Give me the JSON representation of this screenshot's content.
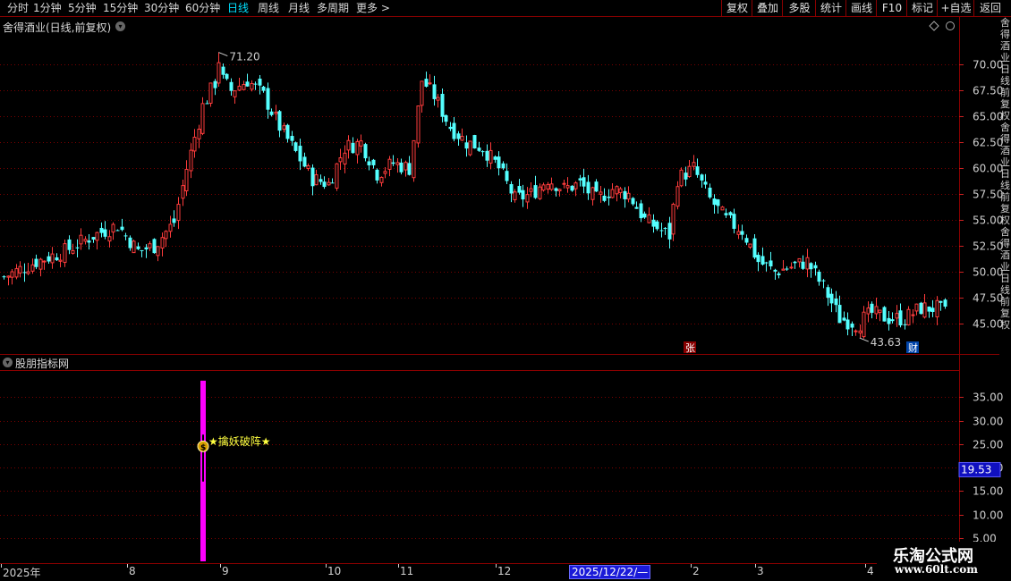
{
  "toolbar": {
    "periods": [
      "分时",
      "1分钟",
      "5分钟",
      "15分钟",
      "30分钟",
      "60分钟",
      "日线",
      "周线",
      "月线",
      "多周期",
      "更多 >"
    ],
    "active_period": "日线",
    "right_buttons": [
      "复权",
      "叠加",
      "多股",
      "统计",
      "画线",
      "F10",
      "标记",
      "+自选",
      "返回"
    ]
  },
  "main_pane": {
    "title": "舍得酒业(日线,前复权)",
    "high_label": "71.20",
    "low_label": "43.63",
    "badge_zhang": "张",
    "badge_cai": "财",
    "price_ticks": [
      "70.00",
      "67.50",
      "65.00",
      "62.50",
      "60.00",
      "57.50",
      "55.00",
      "52.50",
      "50.00",
      "47.50",
      "45.00"
    ]
  },
  "right_strip_text": "舍得酒业日线前复权",
  "indicator_pane": {
    "title": "股朋指标网",
    "signal_text": "★擒妖破阵★",
    "signal_icon": "$",
    "value_ticks": [
      "35.00",
      "30.00",
      "25.00",
      "20.00",
      "15.00",
      "10.00",
      "5.00"
    ],
    "current_value": "19.53"
  },
  "date_axis": {
    "labels": [
      {
        "text": "2025年",
        "idx": 0
      },
      {
        "text": "8",
        "idx": 31
      },
      {
        "text": "9",
        "idx": 54
      },
      {
        "text": "10",
        "idx": 80
      },
      {
        "text": "11",
        "idx": 98
      },
      {
        "text": "12",
        "idx": 122
      },
      {
        "text": "2",
        "idx": 170
      },
      {
        "text": "3",
        "idx": 186
      },
      {
        "text": "4",
        "idx": 213
      }
    ],
    "cursor_label": "2025/12/22/—"
  },
  "watermark": {
    "line1": "乐淘公式网",
    "line2": "www.60lt.com"
  },
  "colors": {
    "up": "#ff3c3c",
    "down": "#54ffff",
    "grid": "#7a0000",
    "bar": "#ff00ff",
    "accent": "#00e0ff"
  },
  "chart_data": [
    {
      "type": "candlestick",
      "title": "舍得酒业(日线,前复权)",
      "y_ticks": [
        70,
        67.5,
        65,
        62.5,
        60,
        57.5,
        55,
        52.5,
        50,
        47.5,
        45
      ],
      "ylim": [
        42.6,
        72.8
      ],
      "high_marker": 71.2,
      "low_marker": 43.63,
      "close_path": [
        [
          0,
          49.5
        ],
        [
          8,
          51.0
        ],
        [
          15,
          52.0
        ],
        [
          22,
          53.5
        ],
        [
          28,
          54.5
        ],
        [
          33,
          52.0
        ],
        [
          37,
          52.5
        ],
        [
          42,
          54.8
        ],
        [
          45,
          60.0
        ],
        [
          49,
          66.0
        ],
        [
          53,
          69.0
        ],
        [
          56,
          67.5
        ],
        [
          60,
          68.5
        ],
        [
          64,
          67.0
        ],
        [
          68,
          64.0
        ],
        [
          72,
          61.5
        ],
        [
          76,
          59.0
        ],
        [
          80,
          58.5
        ],
        [
          84,
          62.0
        ],
        [
          88,
          62.5
        ],
        [
          92,
          59.5
        ],
        [
          96,
          60.5
        ],
        [
          100,
          60.0
        ],
        [
          103,
          68.5
        ],
        [
          106,
          67.0
        ],
        [
          110,
          64.0
        ],
        [
          114,
          62.5
        ],
        [
          118,
          62.0
        ],
        [
          122,
          60.0
        ],
        [
          126,
          57.0
        ],
        [
          130,
          57.5
        ],
        [
          134,
          59.0
        ],
        [
          138,
          58.0
        ],
        [
          142,
          58.5
        ],
        [
          146,
          57.0
        ],
        [
          150,
          58.0
        ],
        [
          154,
          57.5
        ],
        [
          158,
          55.0
        ],
        [
          162,
          54.0
        ],
        [
          164,
          53.5
        ],
        [
          166,
          59.0
        ],
        [
          170,
          60.0
        ],
        [
          174,
          57.0
        ],
        [
          178,
          55.0
        ],
        [
          182,
          54.0
        ],
        [
          186,
          51.0
        ],
        [
          190,
          50.0
        ],
        [
          194,
          50.5
        ],
        [
          198,
          51.0
        ],
        [
          202,
          48.5
        ],
        [
          206,
          45.5
        ],
        [
          210,
          45.0
        ],
        [
          214,
          46.0
        ],
        [
          218,
          45.5
        ],
        [
          222,
          45.5
        ],
        [
          226,
          46.5
        ],
        [
          230,
          46.5
        ],
        [
          232,
          46.0
        ]
      ],
      "series": [
        {
          "name": "K线",
          "color_up": "#ff3c3c",
          "color_down": "#54ffff"
        }
      ]
    },
    {
      "type": "bar",
      "title": "股朋指标网",
      "y_ticks": [
        35,
        30,
        25,
        20,
        15,
        10,
        5
      ],
      "ylim": [
        0,
        40
      ],
      "bars": [
        {
          "idx": 49,
          "value": 38.5,
          "label": "★擒妖破阵★"
        }
      ],
      "current_value": 19.53
    }
  ]
}
